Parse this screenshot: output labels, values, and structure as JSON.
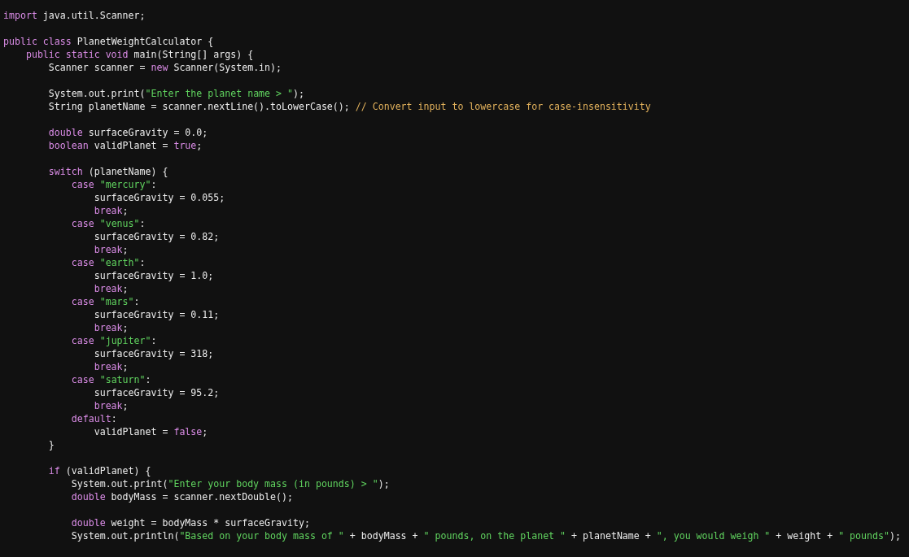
{
  "editor": {
    "lines": [
      {
        "kind": "code",
        "tokens": [
          {
            "kind": "keyword",
            "text": "import"
          },
          {
            "kind": "plain",
            "text": " java.util.Scanner;"
          }
        ]
      },
      {
        "kind": "blank"
      },
      {
        "kind": "code",
        "tokens": [
          {
            "kind": "keyword",
            "text": "public class"
          },
          {
            "kind": "plain",
            "text": " PlanetWeightCalculator {"
          }
        ]
      },
      {
        "kind": "code",
        "tokens": [
          {
            "kind": "keyword",
            "text": "    public static void"
          },
          {
            "kind": "plain",
            "text": " main(String[] args) {"
          }
        ]
      },
      {
        "kind": "code",
        "tokens": [
          {
            "kind": "plain",
            "text": "        Scanner scanner = "
          },
          {
            "kind": "keyword",
            "text": "new"
          },
          {
            "kind": "plain",
            "text": " Scanner(System.in);"
          }
        ]
      },
      {
        "kind": "blank"
      },
      {
        "kind": "code",
        "tokens": [
          {
            "kind": "plain",
            "text": "        System.out.print("
          },
          {
            "kind": "string",
            "text": "\"Enter the planet name > \""
          },
          {
            "kind": "plain",
            "text": ");"
          }
        ]
      },
      {
        "kind": "code",
        "tokens": [
          {
            "kind": "plain",
            "text": "        String planetName = scanner.nextLine().toLowerCase(); "
          },
          {
            "kind": "comment",
            "text": "// Convert input to lowercase for case-insensitivity"
          }
        ]
      },
      {
        "kind": "blank"
      },
      {
        "kind": "code",
        "tokens": [
          {
            "kind": "keyword",
            "text": "        double"
          },
          {
            "kind": "plain",
            "text": " surfaceGravity = 0.0;"
          }
        ]
      },
      {
        "kind": "code",
        "tokens": [
          {
            "kind": "keyword",
            "text": "        boolean"
          },
          {
            "kind": "plain",
            "text": " validPlanet = "
          },
          {
            "kind": "keyword",
            "text": "true"
          },
          {
            "kind": "plain",
            "text": ";"
          }
        ]
      },
      {
        "kind": "blank"
      },
      {
        "kind": "code",
        "tokens": [
          {
            "kind": "keyword",
            "text": "        switch"
          },
          {
            "kind": "plain",
            "text": " (planetName) {"
          }
        ]
      },
      {
        "kind": "code",
        "tokens": [
          {
            "kind": "keyword",
            "text": "            case"
          },
          {
            "kind": "string",
            "text": " \"mercury\""
          },
          {
            "kind": "plain",
            "text": ":"
          }
        ]
      },
      {
        "kind": "code",
        "tokens": [
          {
            "kind": "plain",
            "text": "                surfaceGravity = 0.055;"
          }
        ]
      },
      {
        "kind": "code",
        "tokens": [
          {
            "kind": "keyword",
            "text": "                break"
          },
          {
            "kind": "plain",
            "text": ";"
          }
        ]
      },
      {
        "kind": "code",
        "tokens": [
          {
            "kind": "keyword",
            "text": "            case"
          },
          {
            "kind": "string",
            "text": " \"venus\""
          },
          {
            "kind": "plain",
            "text": ":"
          }
        ]
      },
      {
        "kind": "code",
        "tokens": [
          {
            "kind": "plain",
            "text": "                surfaceGravity = 0.82;"
          }
        ]
      },
      {
        "kind": "code",
        "tokens": [
          {
            "kind": "keyword",
            "text": "                break"
          },
          {
            "kind": "plain",
            "text": ";"
          }
        ]
      },
      {
        "kind": "code",
        "tokens": [
          {
            "kind": "keyword",
            "text": "            case"
          },
          {
            "kind": "string",
            "text": " \"earth\""
          },
          {
            "kind": "plain",
            "text": ":"
          }
        ]
      },
      {
        "kind": "code",
        "tokens": [
          {
            "kind": "plain",
            "text": "                surfaceGravity = 1.0;"
          }
        ]
      },
      {
        "kind": "code",
        "tokens": [
          {
            "kind": "keyword",
            "text": "                break"
          },
          {
            "kind": "plain",
            "text": ";"
          }
        ]
      },
      {
        "kind": "code",
        "tokens": [
          {
            "kind": "keyword",
            "text": "            case"
          },
          {
            "kind": "string",
            "text": " \"mars\""
          },
          {
            "kind": "plain",
            "text": ":"
          }
        ]
      },
      {
        "kind": "code",
        "tokens": [
          {
            "kind": "plain",
            "text": "                surfaceGravity = 0.11;"
          }
        ]
      },
      {
        "kind": "code",
        "tokens": [
          {
            "kind": "keyword",
            "text": "                break"
          },
          {
            "kind": "plain",
            "text": ";"
          }
        ]
      },
      {
        "kind": "code",
        "tokens": [
          {
            "kind": "keyword",
            "text": "            case"
          },
          {
            "kind": "string",
            "text": " \"jupiter\""
          },
          {
            "kind": "plain",
            "text": ":"
          }
        ]
      },
      {
        "kind": "code",
        "tokens": [
          {
            "kind": "plain",
            "text": "                surfaceGravity = 318;"
          }
        ]
      },
      {
        "kind": "code",
        "tokens": [
          {
            "kind": "keyword",
            "text": "                break"
          },
          {
            "kind": "plain",
            "text": ";"
          }
        ]
      },
      {
        "kind": "code",
        "tokens": [
          {
            "kind": "keyword",
            "text": "            case"
          },
          {
            "kind": "string",
            "text": " \"saturn\""
          },
          {
            "kind": "plain",
            "text": ":"
          }
        ]
      },
      {
        "kind": "code",
        "tokens": [
          {
            "kind": "plain",
            "text": "                surfaceGravity = 95.2;"
          }
        ]
      },
      {
        "kind": "code",
        "tokens": [
          {
            "kind": "keyword",
            "text": "                break"
          },
          {
            "kind": "plain",
            "text": ";"
          }
        ]
      },
      {
        "kind": "code",
        "tokens": [
          {
            "kind": "keyword",
            "text": "            default"
          },
          {
            "kind": "plain",
            "text": ":"
          }
        ]
      },
      {
        "kind": "code",
        "tokens": [
          {
            "kind": "plain",
            "text": "                validPlanet = "
          },
          {
            "kind": "keyword",
            "text": "false"
          },
          {
            "kind": "plain",
            "text": ";"
          }
        ]
      },
      {
        "kind": "code",
        "tokens": [
          {
            "kind": "plain",
            "text": "        }"
          }
        ]
      },
      {
        "kind": "blank"
      },
      {
        "kind": "code",
        "tokens": [
          {
            "kind": "keyword",
            "text": "        if"
          },
          {
            "kind": "plain",
            "text": " (validPlanet) {"
          }
        ]
      },
      {
        "kind": "code",
        "tokens": [
          {
            "kind": "plain",
            "text": "            System.out.print("
          },
          {
            "kind": "string",
            "text": "\"Enter your body mass (in pounds) > \""
          },
          {
            "kind": "plain",
            "text": ");"
          }
        ]
      },
      {
        "kind": "code",
        "tokens": [
          {
            "kind": "keyword",
            "text": "            double"
          },
          {
            "kind": "plain",
            "text": " bodyMass = scanner.nextDouble();"
          }
        ]
      },
      {
        "kind": "blank"
      },
      {
        "kind": "code",
        "tokens": [
          {
            "kind": "keyword",
            "text": "            double"
          },
          {
            "kind": "plain",
            "text": " weight = bodyMass * surfaceGravity;"
          }
        ]
      },
      {
        "kind": "code",
        "tokens": [
          {
            "kind": "plain",
            "text": "            System.out.println("
          },
          {
            "kind": "string",
            "text": "\"Based on your body mass of \""
          },
          {
            "kind": "plain",
            "text": " + bodyMass + "
          },
          {
            "kind": "string",
            "text": "\" pounds, on the planet \""
          },
          {
            "kind": "plain",
            "text": " + planetName + "
          },
          {
            "kind": "string",
            "text": "\", you would weigh \""
          },
          {
            "kind": "plain",
            "text": " + weight + "
          },
          {
            "kind": "string",
            "text": "\" pounds\""
          },
          {
            "kind": "plain",
            "text": ");"
          }
        ]
      }
    ]
  }
}
